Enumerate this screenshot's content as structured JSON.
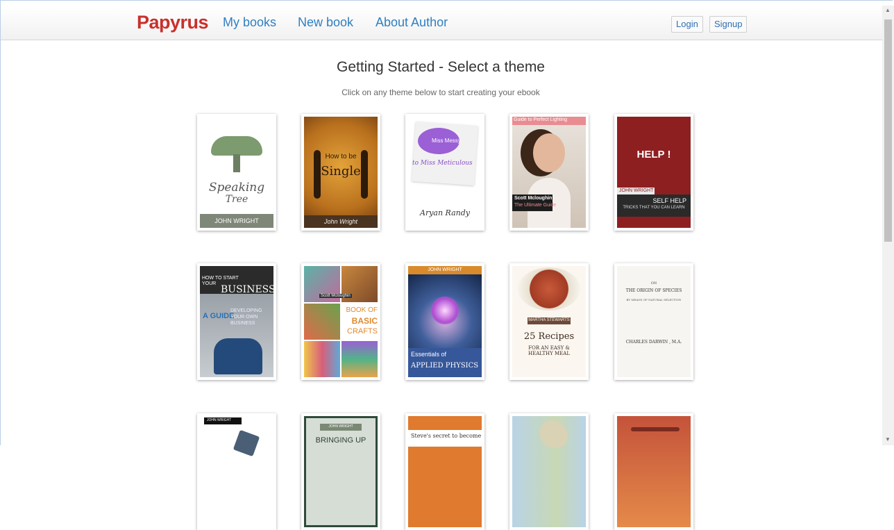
{
  "nav": {
    "brand": "Papyrus",
    "links": [
      "My books",
      "New book",
      "About Author"
    ],
    "login": "Login",
    "signup": "Signup"
  },
  "page": {
    "title": "Getting Started - Select a theme",
    "subtitle": "Click on any theme below to start creating your ebook"
  },
  "themes": [
    {
      "title1": "Speaking",
      "title2": "Tree",
      "author": "JOHN WRIGHT"
    },
    {
      "title1": "How to be",
      "title2": "Single",
      "author": "John Wright"
    },
    {
      "title1": "Miss Messy",
      "title2": "to Miss Meticulous",
      "author": "Aryan Randy"
    },
    {
      "title1": "Guide to Perfect Lighting",
      "title2": "The Ultimate Guide",
      "author": "Scott Mcloughin"
    },
    {
      "title1": "HELP !",
      "title2": "SELF HELP",
      "title3": "TRICKS THAT YOU CAN LEARN",
      "author": "JOHN WRIGHT"
    },
    {
      "title1": "HOW TO START YOUR",
      "title2": "BUSINESS",
      "title3": "A GUIDE",
      "title4": "DEVELOPING YOUR OWN BUSINESS"
    },
    {
      "title1": "BOOK OF",
      "title2": "BASIC",
      "title3": "CRAFTS",
      "author": "Scott Mcloughin"
    },
    {
      "title1": "Essentials of",
      "title2": "APPLIED PHYSICS",
      "author": "JOHN WRIGHT"
    },
    {
      "title1": "25 Recipes",
      "title2": "FOR AN EASY & HEALTHY MEAL",
      "author": "MARTHA STEWARTS"
    },
    {
      "title1": "ON",
      "title2": "THE ORIGIN OF SPECIES",
      "title3": "BY MEANS OF NATURAL SELECTION",
      "author": "CHARLES DARWIN , M.A."
    },
    {
      "author": "JOHN WRIGHT"
    },
    {
      "title1": "BRINGING UP",
      "author": "JOHN WRIGHT"
    },
    {
      "title1": "Steve's secret to become"
    },
    {},
    {}
  ]
}
